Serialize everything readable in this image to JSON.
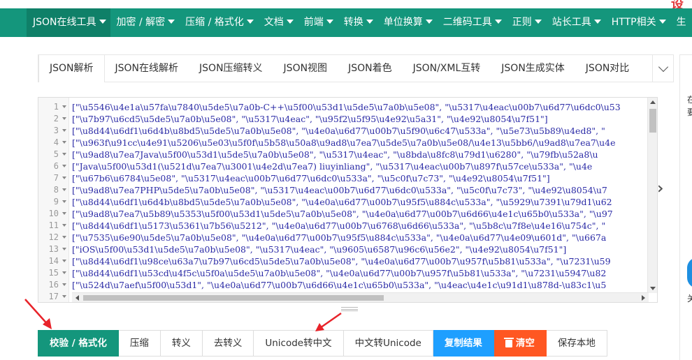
{
  "corner_glyph": "设",
  "nav": {
    "items": [
      {
        "label": "JSON在线工具"
      },
      {
        "label": "加密 / 解密"
      },
      {
        "label": "压缩 / 格式化"
      },
      {
        "label": "文档"
      },
      {
        "label": "前端"
      },
      {
        "label": "转换"
      },
      {
        "label": "单位换算"
      },
      {
        "label": "二维码工具"
      },
      {
        "label": "正则"
      },
      {
        "label": "站长工具"
      },
      {
        "label": "HTTP相关"
      },
      {
        "label": "生"
      }
    ]
  },
  "tabs": [
    {
      "label": "JSON解析"
    },
    {
      "label": "JSON在线解析"
    },
    {
      "label": "JSON压缩转义"
    },
    {
      "label": "JSON视图"
    },
    {
      "label": "JSON着色"
    },
    {
      "label": "JSON/XML互转"
    },
    {
      "label": "JSON生成实体"
    },
    {
      "label": "JSON对比"
    }
  ],
  "editor": {
    "line_numbers": [
      "1",
      "2",
      "3",
      "4",
      "5",
      "6",
      "7",
      "8",
      "9",
      "10",
      "11",
      "12",
      "13",
      "14",
      "15",
      "16",
      "17"
    ],
    "lines": [
      "[\"\\u5546\\u4e1a\\u57fa\\u7840\\u5de5\\u7a0b-C++\\u5f00\\u53d1\\u5de5\\u7a0b\\u5e08\", \"\\u5317\\u4eac\\u00b7\\u6d77\\u6dc0\\u53",
      "[\"\\u7b97\\u6cd5\\u5de5\\u7a0b\\u5e08\", \"\\u5317\\u4eac\", \"\\u95f2\\u5f95\\u4e92\\u5a31\", \"\\u4e92\\u8054\\u7f51\"]",
      "[\"\\u8d44\\u6df1\\u6d4b\\u8bd5\\u5de5\\u7a0b\\u5e08\", \"\\u4e0a\\u6d77\\u00b7\\u5f90\\u6c47\\u533a\", \"\\u5e73\\u5b89\\u4ed8\", \"",
      "[\"\\u963f\\u91cc\\u4e91\\u5206\\u5e03\\u5f0f\\u5b58\\u50a8\\u9ad8\\u7ea7\\u5de5\\u7a0b\\u5e08/\\u4e13\\u5bb6/\\u9ad8\\u7ea7\\u4e",
      "[\"\\u9ad8\\u7ea7Java\\u5f00\\u53d1\\u5de5\\u7a0b\\u5e08\", \"\\u5317\\u4eac\", \"\\u8bda\\u8fc8\\u79d1\\u6280\", \"\\u79fb\\u52a8\\u",
      "[\"Java\\u5f00\\u53d1(\\u521d\\u7ea7\\u3001\\u4e2d\\u7ea7) liuyinliang\", \"\\u5317\\u4eac\\u00b7\\u897f\\u57ce\\u533a\", \"\\u4e",
      "[\"\\u67b6\\u6784\\u5e08\", \"\\u5317\\u4eac\\u00b7\\u6d77\\u6dc0\\u533a\", \"\\u5c0f\\u7c73\", \"\\u4e92\\u8054\\u7f51\"]",
      "[\"\\u9ad8\\u7ea7PHP\\u5de5\\u7a0b\\u5e08\", \"\\u5317\\u4eac\\u00b7\\u6d77\\u6dc0\\u533a\", \"\\u5c0f\\u7c73\", \"\\u4e92\\u8054\\u7",
      "[\"\\u8d44\\u6df1\\u6d4b\\u8bd5\\u5de5\\u7a0b\\u5e08\", \"\\u4e0a\\u6d77\\u00b7\\u95f5\\u884c\\u533a\", \"\\u5929\\u7391\\u79d1\\u62",
      "[\"\\u9ad8\\u7ea7\\u5b89\\u5353\\u5f00\\u53d1\\u5de5\\u7a0b\\u5e08\", \"\\u4e0a\\u6d77\\u00b7\\u6d66\\u4e1c\\u65b0\\u533a\", \"\\u97",
      "[\"\\u8d44\\u6df1\\u5173\\u5361\\u7b56\\u5212\", \"\\u4e0a\\u6d77\\u00b7\\u6768\\u6d66\\u533a\", \"\\u5b8c\\u7f8e\\u4e16\\u754c\", \"",
      "[\"\\u7535\\u6e90\\u5de5\\u7a0b\\u5e08\", \"\\u4e0a\\u6d77\\u00b7\\u95f5\\u884c\\u533a\", \"\\u4e0a\\u6d77\\u4e09\\u601d\", \"\\u667a",
      "[\"iOS\\u5f00\\u53d1\\u5de5\\u7a0b\\u5e08\", \"\\u5317\\u4eac\", \"\\u9605\\u6587\\u96c6\\u56e2\", \"\\u4e92\\u8054\\u7f51\"]",
      "[\"\\u8d44\\u6df1\\u98ce\\u63a7\\u7b97\\u6cd5\\u5de5\\u7a0b\\u5e08\", \"\\u4e0a\\u6d77\\u00b7\\u957f\\u5b81\\u533a\", \"\\u7231\\u59",
      "[\"\\u8d44\\u6df1\\u53cd\\u4f5c\\u5f0a\\u5de5\\u7a0b\\u5e08\", \"\\u4e0a\\u6d77\\u00b7\\u957f\\u5b81\\u533a\", \"\\u7231\\u5947\\u82",
      "[\"\\u524d\\u7aef\\u5f00\\u53d1\", \"\\u4e0a\\u6d77\\u00b7\\u6d66\\u4e1c\\u65b0\\u533a\", \"\\u4eac\\u4e1c\\u91d1\\u878d-\\u83c1\\u5",
      ""
    ]
  },
  "right_panel": {
    "text_1": "在",
    "text_2": "要",
    "text_3": "关"
  },
  "buttons": [
    {
      "label": "校验 / 格式化"
    },
    {
      "label": "压缩"
    },
    {
      "label": "转义"
    },
    {
      "label": "去转义"
    },
    {
      "label": "Unicode转中文"
    },
    {
      "label": "中文转Unicode"
    },
    {
      "label": "复制结果"
    },
    {
      "label": "清空"
    },
    {
      "label": "保存本地"
    }
  ],
  "colors": {
    "brand_green": "#14967c",
    "blue": "#1e9fff",
    "orange": "#ff5722",
    "annotation_red": "#e8232a"
  }
}
